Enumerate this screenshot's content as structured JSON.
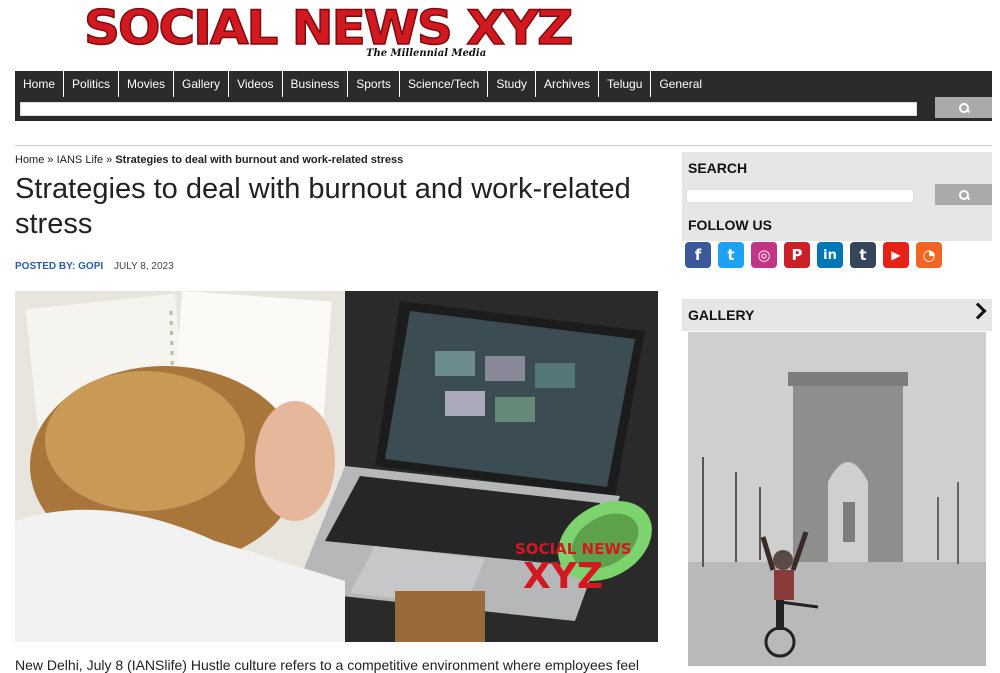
{
  "logo": {
    "main": "SOCIAL NEWS XYZ",
    "tagline": "The Millennial Media"
  },
  "nav": [
    "Home",
    "Politics",
    "Movies",
    "Gallery",
    "Videos",
    "Business",
    "Sports",
    "Science/Tech",
    "Study",
    "Archives",
    "Telugu",
    "General"
  ],
  "breadcrumb": {
    "home": "Home",
    "sep": "»",
    "category": "IANS Life",
    "current": "Strategies to deal with burnout and work-related stress"
  },
  "article": {
    "title": "Strategies to deal with burnout and work-related stress",
    "posted_by": "POSTED BY: GOPI",
    "date": "JULY 8, 2023",
    "hero_watermark_top": "SOCIAL NEWS",
    "hero_watermark_xyz": "XYZ",
    "body_start": "New Delhi, July 8 (IANSlife) Hustle culture refers to a competitive environment where employees feel"
  },
  "sidebar": {
    "search_title": "SEARCH",
    "follow_title": "FOLLOW US",
    "gallery_title": "GALLERY"
  },
  "social": [
    {
      "name": "facebook-icon",
      "glyph": "f",
      "color": "#3b5998"
    },
    {
      "name": "twitter-icon",
      "glyph": "t",
      "color": "#1da1f2"
    },
    {
      "name": "instagram-icon",
      "glyph": "◎",
      "color": "#c13584"
    },
    {
      "name": "pinterest-icon",
      "glyph": "P",
      "color": "#cb2027"
    },
    {
      "name": "linkedin-icon",
      "glyph": "in",
      "color": "#0077b5"
    },
    {
      "name": "tumblr-icon",
      "glyph": "t",
      "color": "#35465c"
    },
    {
      "name": "youtube-icon",
      "glyph": "▶",
      "color": "#e62117"
    },
    {
      "name": "rss-icon",
      "glyph": "◔",
      "color": "#f26522"
    }
  ],
  "colors": {
    "nav_bg": "#2b2b2b",
    "logo_red": "#d31920",
    "accent_blue": "#2a5ca8",
    "sidebar_head_bg": "#e6e6e6"
  }
}
